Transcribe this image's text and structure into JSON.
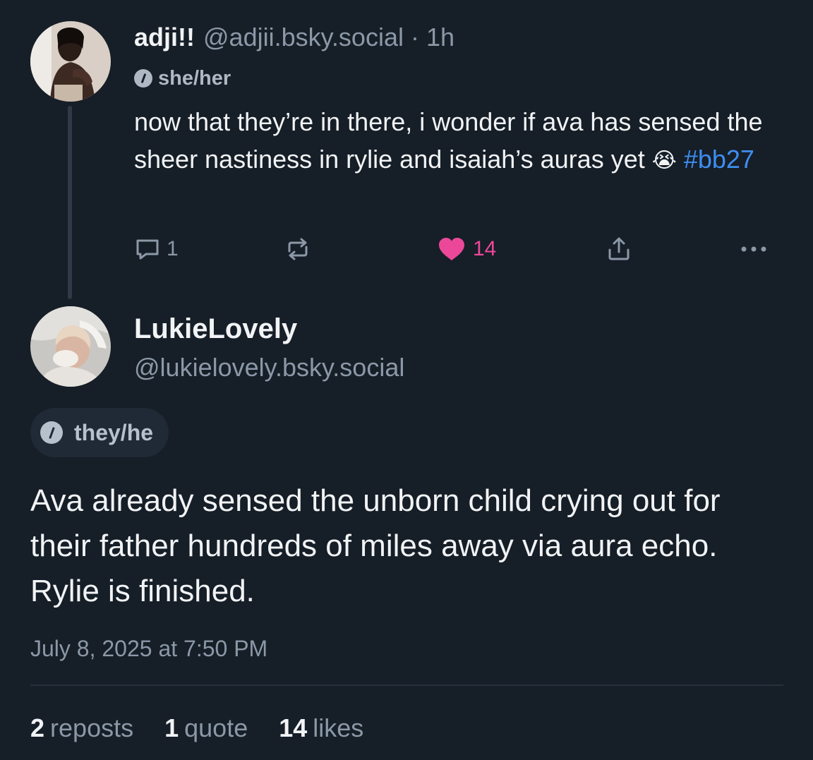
{
  "parent_post": {
    "display_name": "adji!!",
    "handle": "@adjii.bsky.social",
    "separator": "·",
    "time_ago": "1h",
    "pronouns": "she/her",
    "text_main": "now that they’re in there, i wonder if ava has sensed the sheer nastiness in rylie and isaiah’s auras yet",
    "emoji": "😭",
    "hashtag": "#bb27",
    "reply_count": "1",
    "repost_count": "",
    "like_count": "14",
    "icons": {
      "reply": "speech-bubble-icon",
      "repost": "repost-arrows-icon",
      "like": "heart-icon",
      "share": "share-upload-icon",
      "more": "more-dots-icon",
      "pronoun": "pronoun-circle-icon"
    }
  },
  "main_post": {
    "display_name": "LukieLovely",
    "handle": "@lukielovely.bsky.social",
    "pronouns": "they/he",
    "text": "Ava already sensed the unborn child crying out for their father hundreds of miles away via aura echo. Rylie is finished.",
    "timestamp": "July 8, 2025 at 7:50 PM",
    "stats": {
      "reposts_count": "2",
      "reposts_label": "reposts",
      "quotes_count": "1",
      "quotes_label": "quote",
      "likes_count": "14",
      "likes_label": "likes"
    }
  },
  "colors": {
    "background": "#161e27",
    "text_primary": "#f1f3f5",
    "text_muted": "#8b98a7",
    "hashtag": "#3d8ef0",
    "like_pink": "#ec4899",
    "pill_bg": "#1f2a36"
  }
}
